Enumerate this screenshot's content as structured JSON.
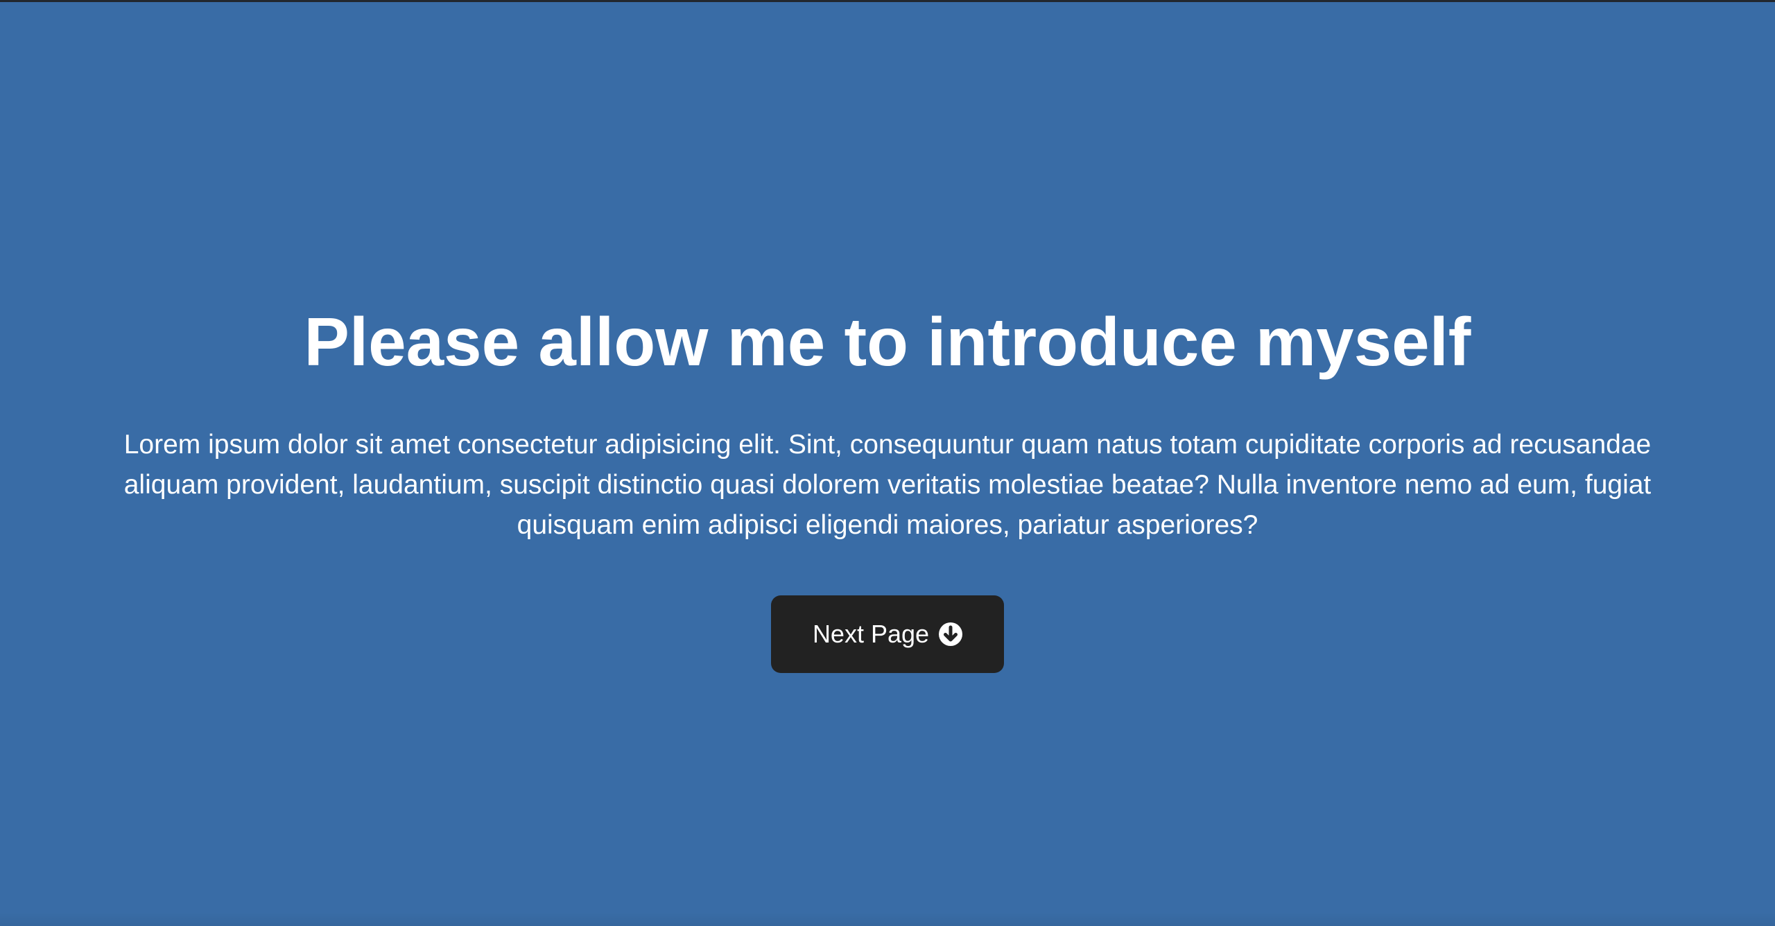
{
  "hero": {
    "title": "Please allow me to introduce myself",
    "text": "Lorem ipsum dolor sit amet consectetur adipisicing elit. Sint, consequuntur quam natus totam cupiditate corporis ad recusandae aliquam provident, laudantium, suscipit distinctio quasi dolorem veritatis molestiae beatae? Nulla inventore nemo ad eum, fugiat quisquam enim adipisci eligendi maiores, pariatur asperiores?",
    "button_label": "Next Page",
    "button_icon": "arrow-circle-down-icon"
  },
  "colors": {
    "background": "#396ca6",
    "button": "#222222",
    "text": "#ffffff"
  }
}
